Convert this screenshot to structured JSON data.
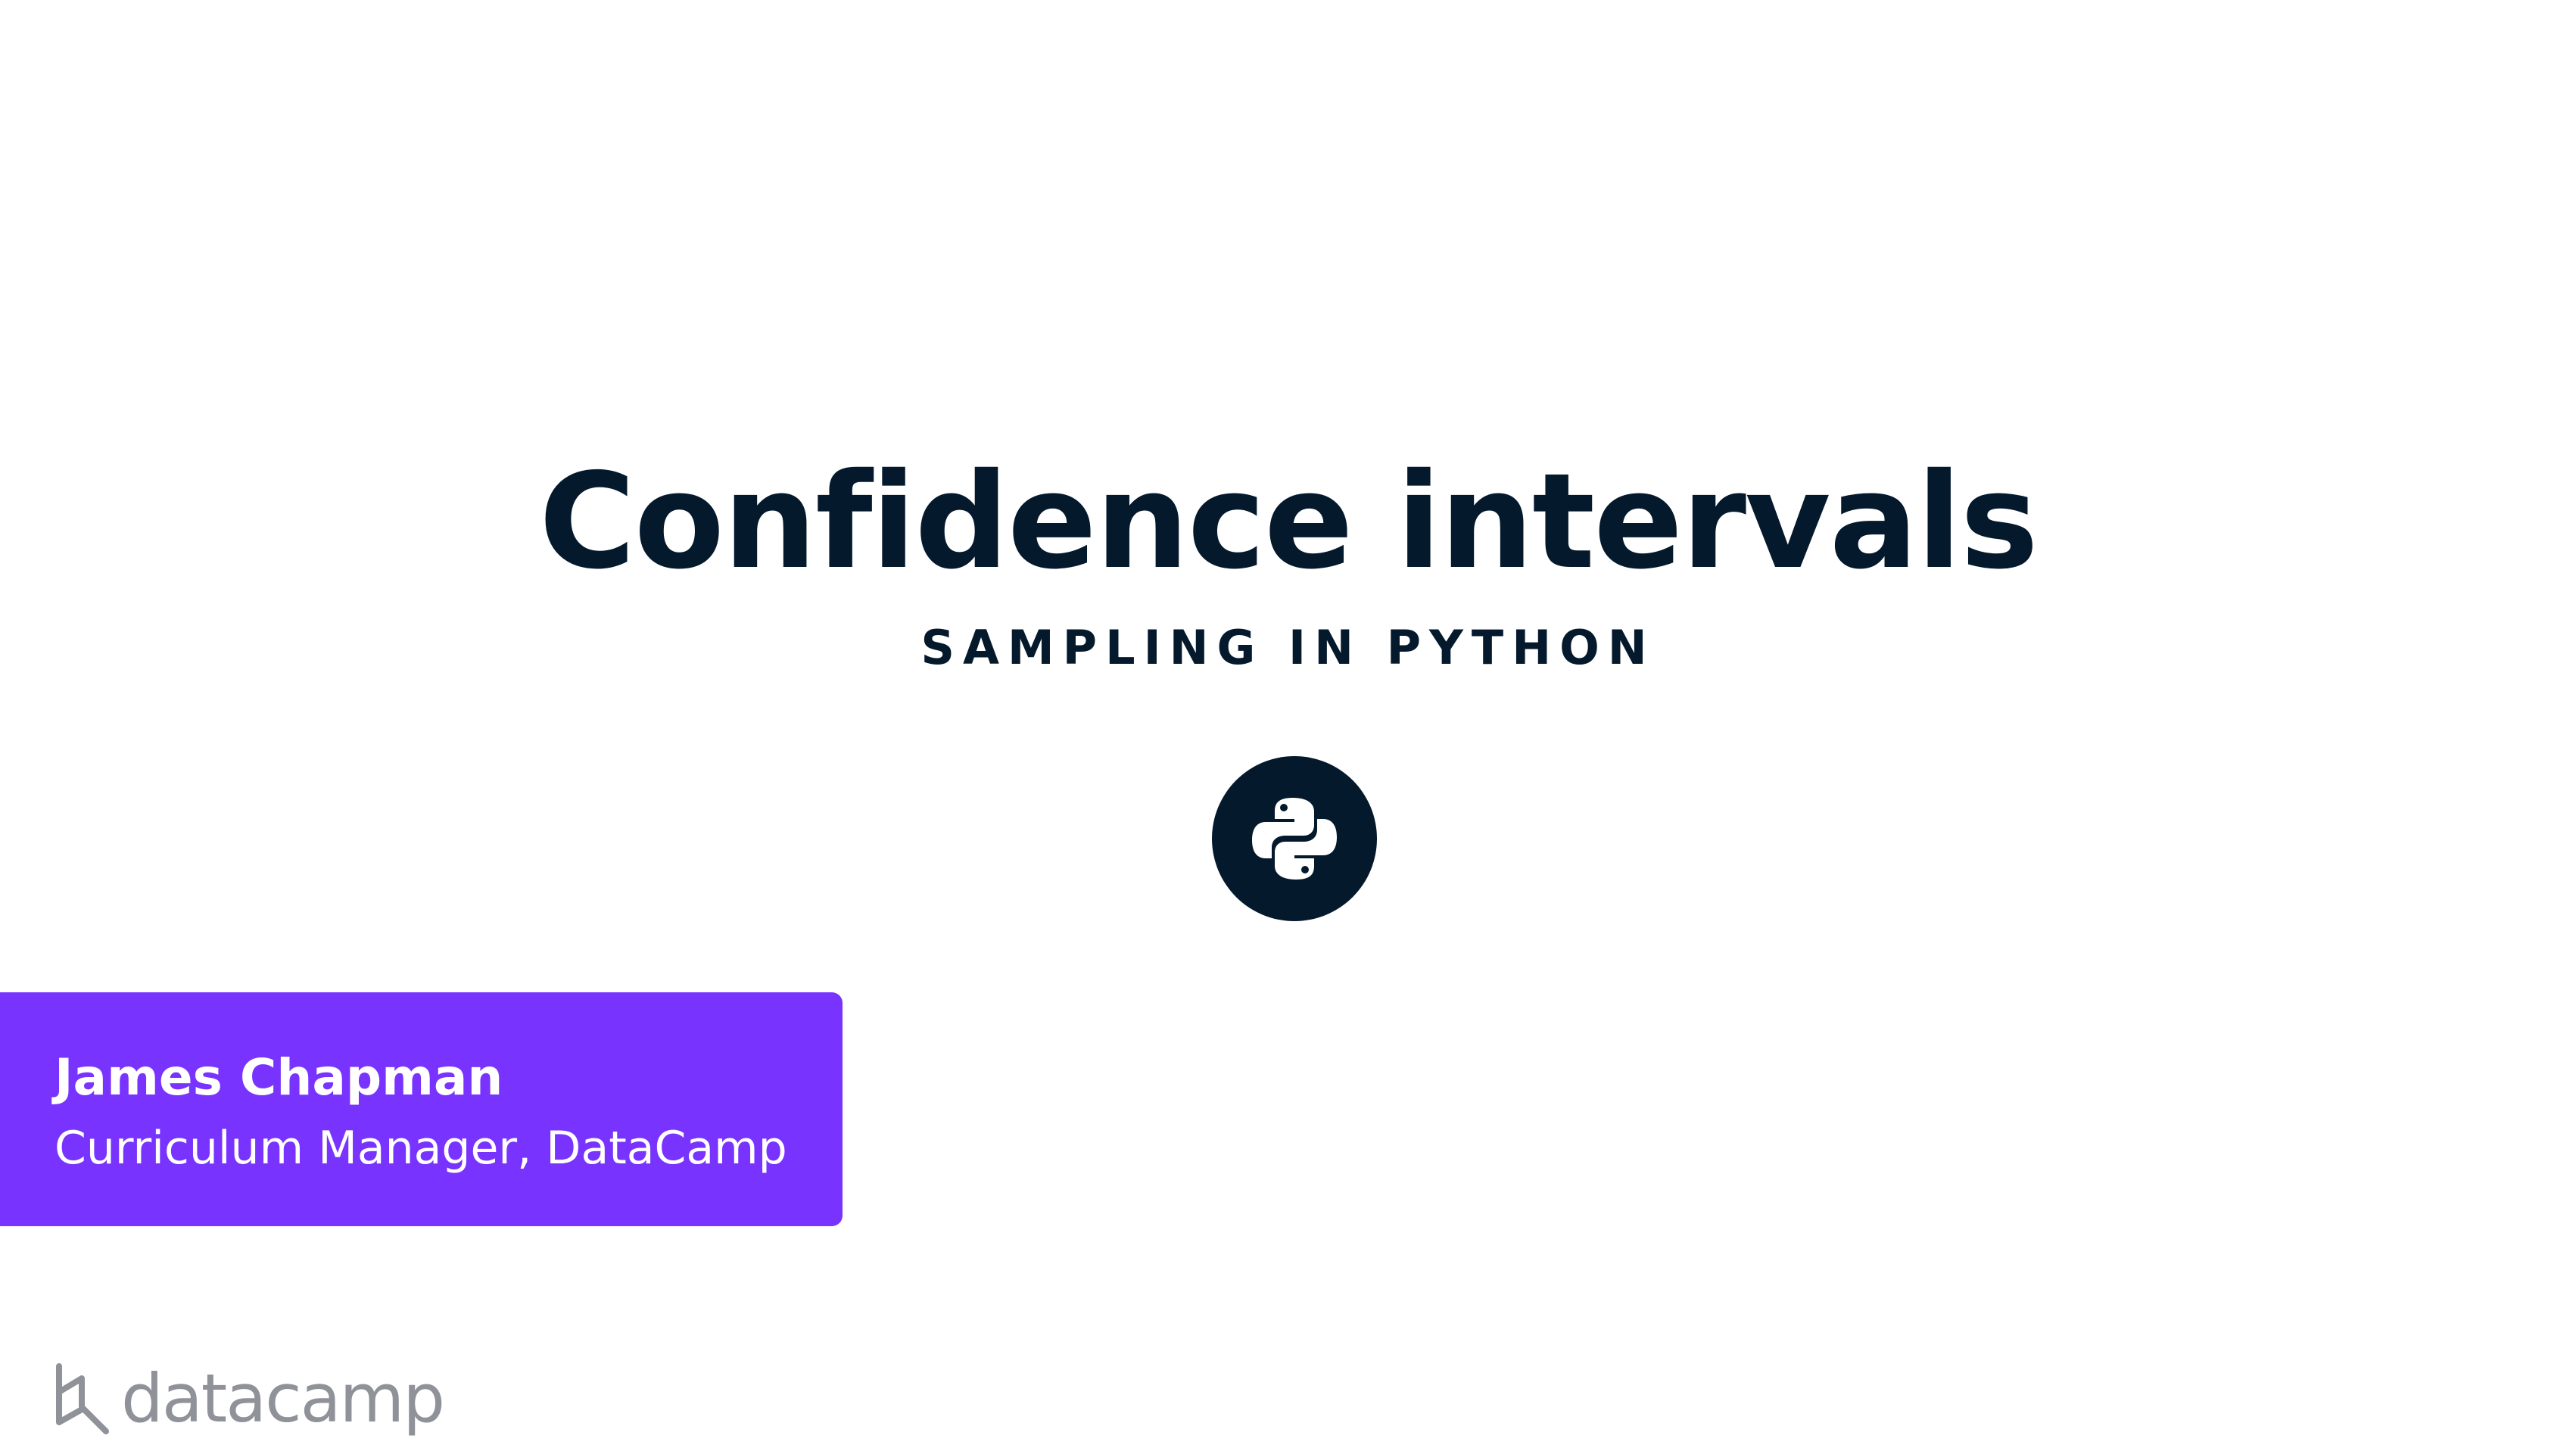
{
  "slide": {
    "title": "Confidence intervals",
    "course": "SAMPLING IN PYTHON",
    "icon": "python-logo-icon"
  },
  "instructor": {
    "name": "James Chapman",
    "role": "Curriculum Manager, DataCamp"
  },
  "brand": {
    "logo_text": "datacamp"
  },
  "colors": {
    "navy": "#05192d",
    "purple": "#7933ff",
    "logo_gray": "#8f9299",
    "background": "#ffffff"
  }
}
